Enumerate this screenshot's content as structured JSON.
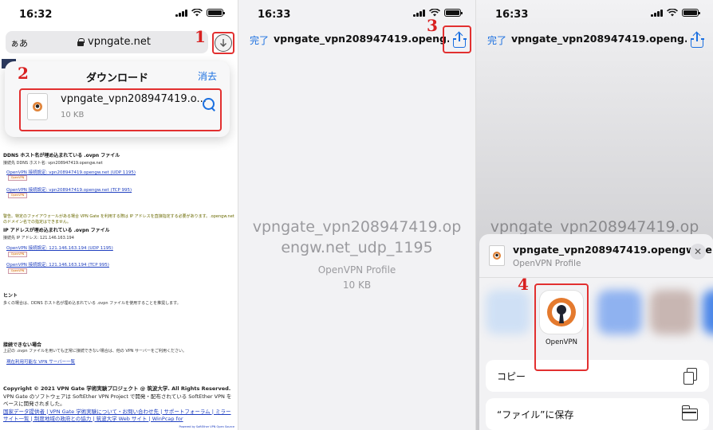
{
  "step_numbers": [
    "1",
    "2",
    "3",
    "4"
  ],
  "panel1": {
    "status_time": "16:32",
    "addressbar": {
      "aa": "ぁあ",
      "url": "vpngate.net"
    },
    "download_popup": {
      "title": "ダウンロード",
      "clear": "消去",
      "item": {
        "name": "vpngate_vpn208947419.o...",
        "size": "10 KB"
      }
    },
    "page": {
      "heading1": "DDNS ホスト名が埋め込まれている .ovpn ファイル",
      "ddns_host": "接続先 DDNS ホスト名: vpn208947419.opengw.net",
      "link_udp1": "OpenVPN 接続設定: vpn208947419.opengw.net (UDP 1195)",
      "link_tcp1": "OpenVPN 接続設定: vpn208947419.opengw.net (TCP 995)",
      "warning": "警告。特定のファイアウォールがある場合 VPN Gate を利用する際は IP アドレスを直接指定する必要があります。.opengw.net のドメイン名での指定はできません。",
      "heading2": "IP アドレスが埋め込まれている .ovpn ファイル",
      "ip_addr": "接続先 IP アドレス: 121.146.163.194",
      "link_udp2": "OpenVPN 接続設定: 121.146.163.194 (UDP 1195)",
      "link_tcp2": "OpenVPN 接続設定: 121.146.163.194 (TCP 995)",
      "badge": "OpenVPN",
      "hint_heading": "ヒント",
      "hint_text": "多くの場合は、DDNS ホスト名が埋め込まれている .ovpn ファイルを使用することを推奨します。",
      "fail_heading": "接続できない場合",
      "fail_text": "上記の .ovpn ファイルを用いても正常に接続できない場合は、他の VPN サーバーをご利用ください。",
      "fail_link": "現在利用可能な VPN サーバー一覧",
      "footer_line1": "Copyright © 2021 VPN Gate 学術実験プロジェクト @ 筑波大学. All Rights Reserved.",
      "footer_line2": "VPN Gate のソフトウェアは SoftEther VPN Project で開発・配布されている SoftEther VPN をベースに開発されました。",
      "footer_links": "国家データ提供者 | VPN Gate 学術実験について・お問い合わせ先 | サポートフォーラム | ミラーサイト一覧 | 制度地域の政府との協力 | 筑波大学 Web サイト | WinPcap for",
      "footer_small": "Powered by SoftEther VPN Open Source"
    }
  },
  "panel2": {
    "status_time": "16:33",
    "done": "完了",
    "nav_title": "vpngate_vpn208947419.openg...",
    "file_name_line1": "vpngate_vpn208947419.op",
    "file_name_line2": "engw.net_udp_1195",
    "file_type": "OpenVPN Profile",
    "file_size": "10 KB"
  },
  "panel3": {
    "status_time": "16:33",
    "done": "完了",
    "nav_title": "vpngate_vpn208947419.openg...",
    "behind_name": "vpngate_vpn208947419.op",
    "sheet": {
      "file_name": "vpngate_vpn208947419.opengw.ne...",
      "file_type": "OpenVPN Profile",
      "app_label": "OpenVPN",
      "actions": [
        "コピー",
        "“ファイル”に保存"
      ]
    }
  },
  "colors": {
    "accent": "#1a6fe0",
    "annotation_red": "#e23030",
    "openvpn_orange": "#e47a2e"
  }
}
